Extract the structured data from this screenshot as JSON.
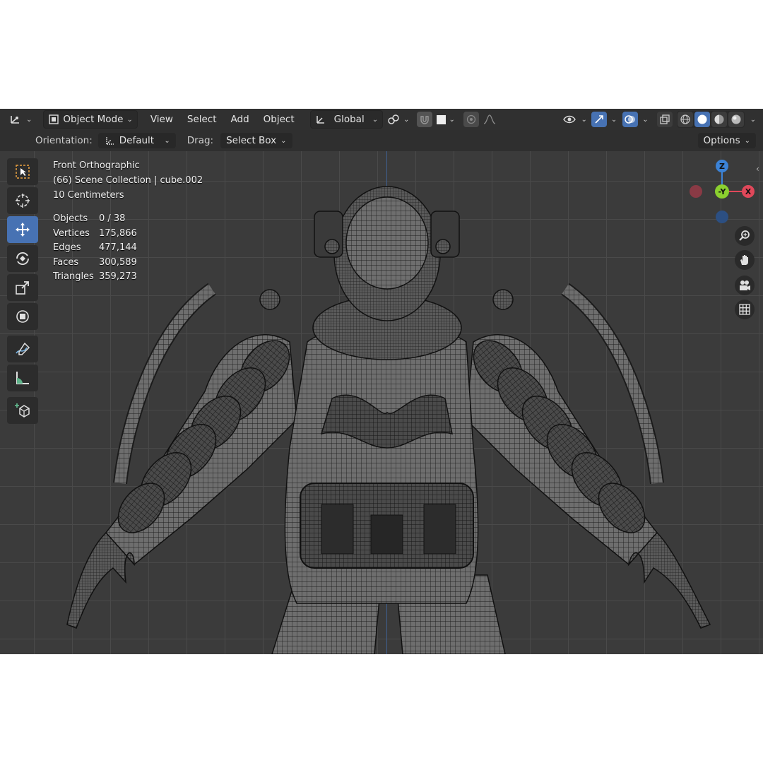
{
  "header": {
    "editor_type_icon": "axes-icon",
    "mode": "Object Mode",
    "menu": [
      "View",
      "Select",
      "Add",
      "Object"
    ],
    "transform_orientation": "Global"
  },
  "tool_settings": {
    "orientation_label": "Orientation:",
    "orientation_value": "Default",
    "drag_label": "Drag:",
    "drag_value": "Select Box",
    "options": "Options"
  },
  "viewport": {
    "view_name": "Front Orthographic",
    "collection": "(66) Scene Collection | cube.002",
    "scale": "10 Centimeters",
    "stats": [
      {
        "label": "Objects",
        "value": "0 / 38"
      },
      {
        "label": "Vertices",
        "value": "175,866"
      },
      {
        "label": "Edges",
        "value": "477,144"
      },
      {
        "label": "Faces",
        "value": "300,589"
      },
      {
        "label": "Triangles",
        "value": "359,273"
      }
    ],
    "gizmo": {
      "z": "Z",
      "y": "-Y",
      "x": "X"
    }
  },
  "colors": {
    "accent": "#4772b3",
    "axis_x": "#e0485a",
    "axis_y": "#8bd02f",
    "axis_z": "#3b82d6"
  },
  "tools": [
    "select-box-icon",
    "cursor-icon",
    "move-icon",
    "rotate-icon",
    "scale-icon",
    "transform-icon",
    "annotate-icon",
    "measure-icon",
    "add-cube-icon"
  ],
  "nav_buttons": [
    "zoom-icon",
    "pan-hand-icon",
    "camera-icon",
    "grid-icon"
  ]
}
